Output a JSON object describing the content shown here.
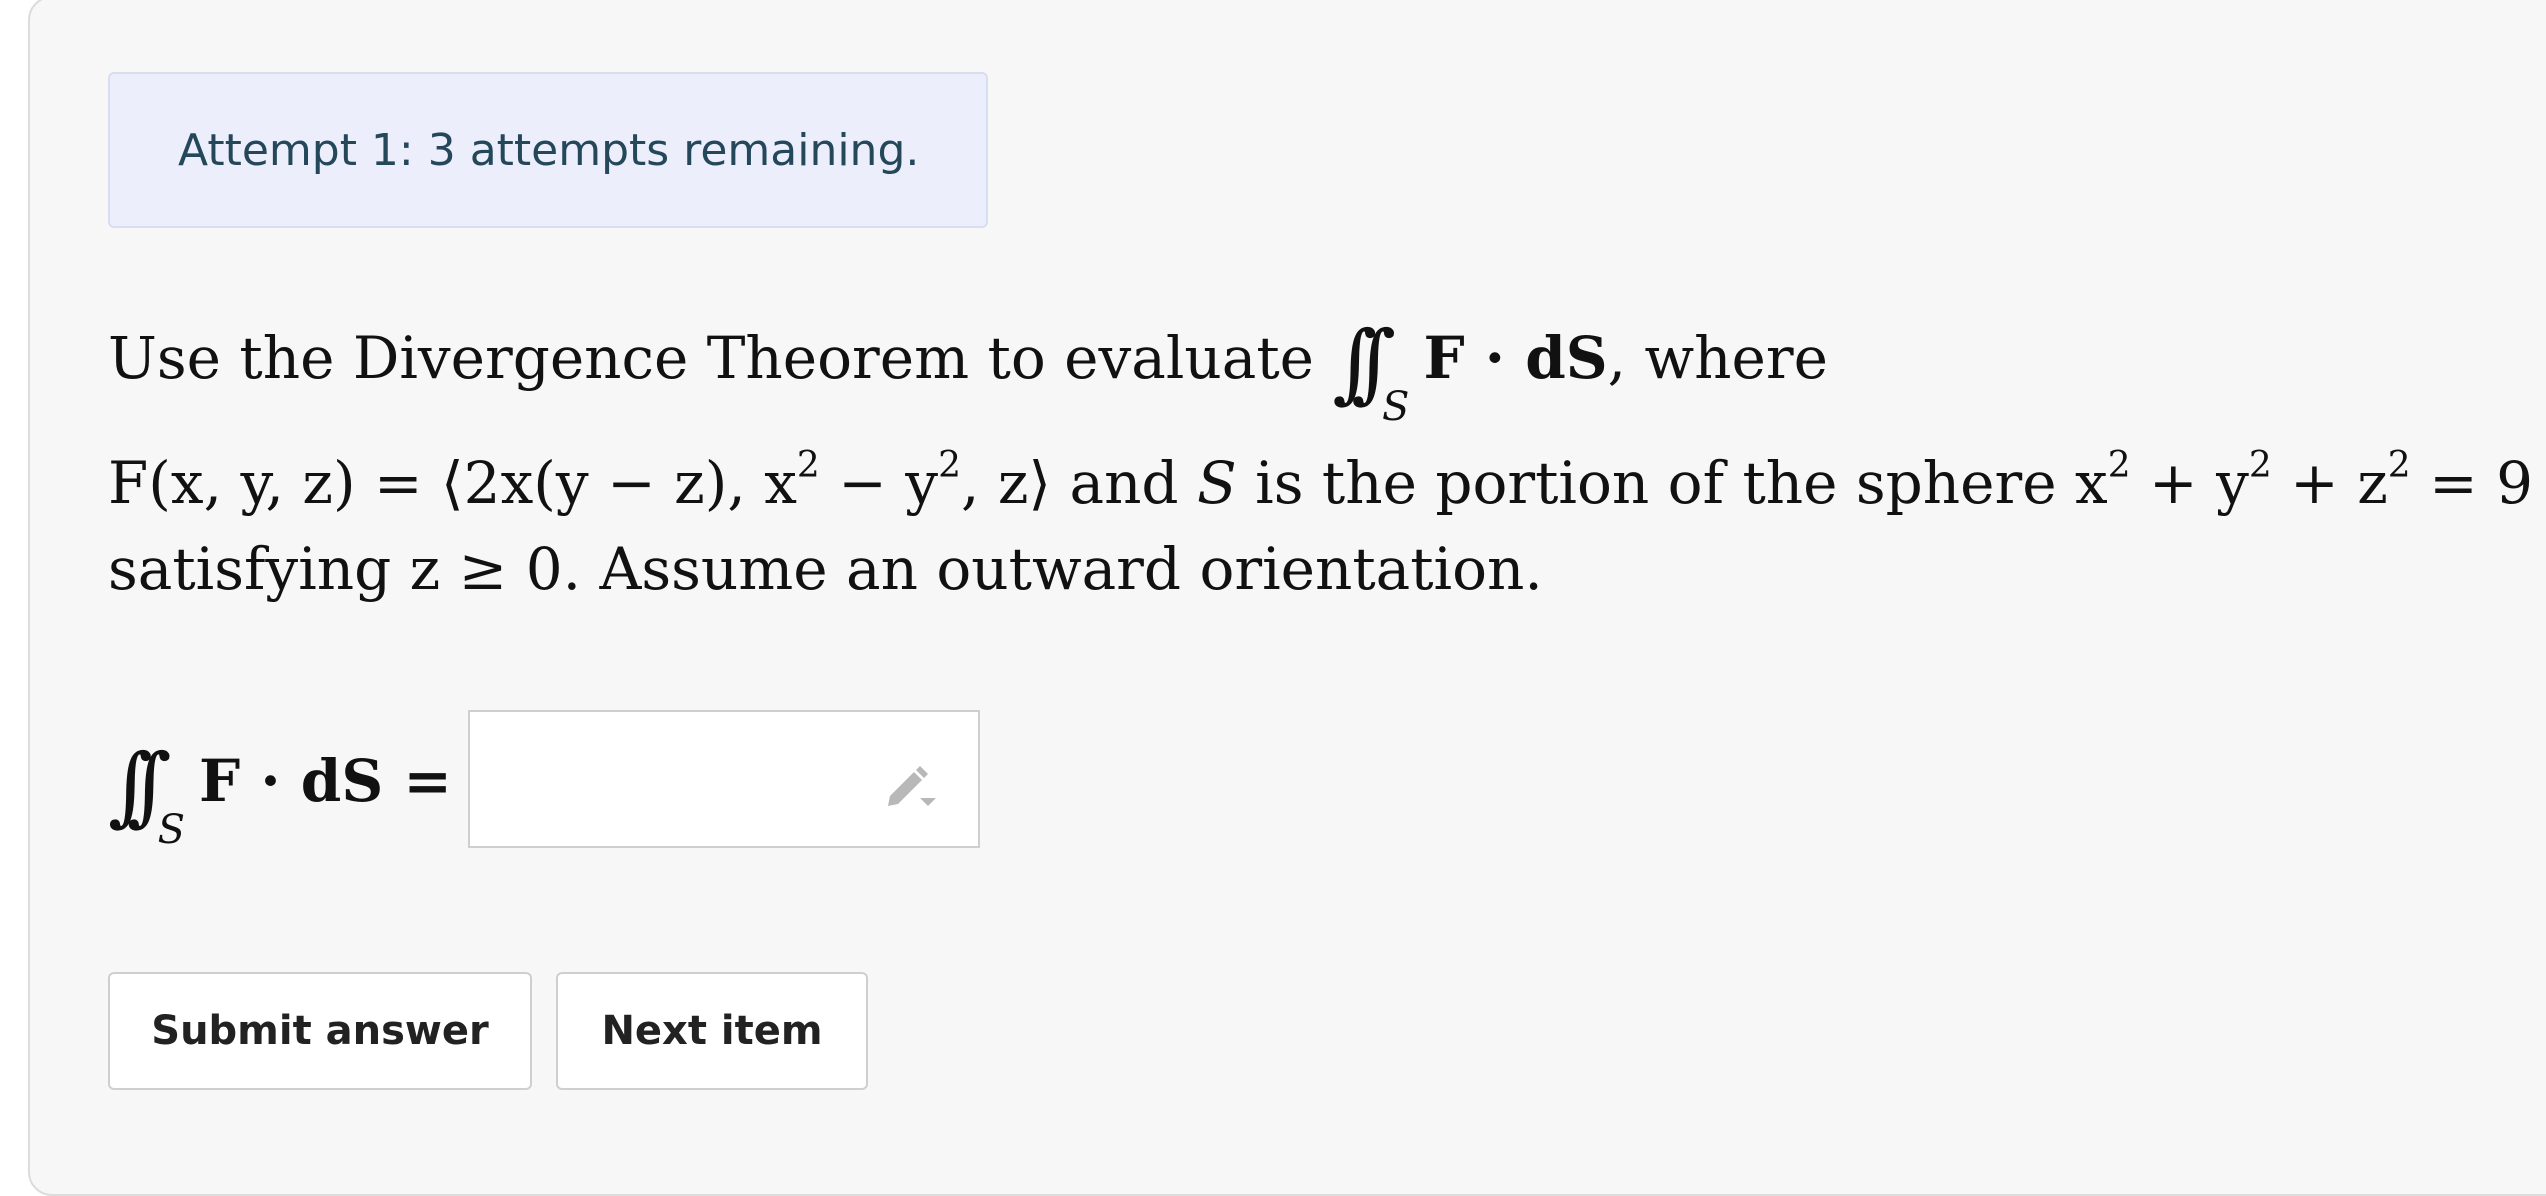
{
  "attempt": {
    "text": "Attempt 1: 3 attempts remaining."
  },
  "question": {
    "intro": "Use the Divergence Theorem to evaluate",
    "integral_sign": "∫∫",
    "integral_sub": "S",
    "integrand": "F · dS",
    "where": ", where",
    "field_lhs": "F(x, y, z) = ⟨2x(y − z), x",
    "field_mid": " − y",
    "field_end": ", z⟩",
    "and_text": " and ",
    "S_letter": "S",
    "sphere_text": " is the portion of the sphere x",
    "sphere_plus_y": " + y",
    "sphere_plus_z": " + z",
    "sphere_eq": " = 9",
    "exp": "2",
    "condition": "satisfying z ≥ 0. Assume an outward orientation."
  },
  "answer": {
    "integral_sign": "∫∫",
    "integral_sub": "S",
    "lhs": "F · dS =",
    "value": "",
    "edit_icon": "pencil-icon"
  },
  "buttons": {
    "submit": "Submit answer",
    "next": "Next item"
  }
}
